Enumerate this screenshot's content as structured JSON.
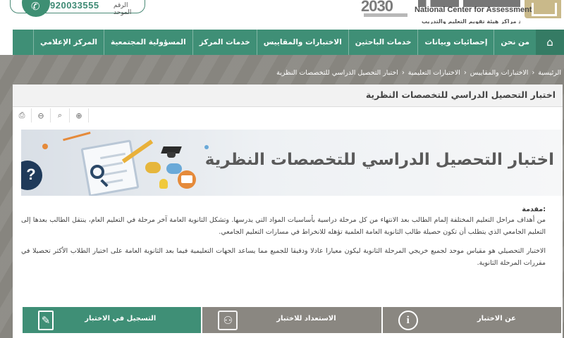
{
  "header": {
    "hotline_label": "الرقم الموحد",
    "hotline_number": "920033555",
    "center_name_en": "National Center for Assessment",
    "center_subtitle": "أحد مراكز هيئة تقويم التعليم والتدريب",
    "vision_year": "2030"
  },
  "nav": {
    "items": [
      "من نحن",
      "إحصائيات وبيانات",
      "خدمات الباحثين",
      "الاختبارات والمقاييس",
      "خدمات المركز",
      "المسؤولية المجتمعية",
      "المركز الإعلامي"
    ]
  },
  "breadcrumb": [
    "الرئيسية",
    "الاختبارات والمقاييس",
    "الاختبارات التعليمية",
    "اختبار التحصيل الدراسي للتخصصات النظرية"
  ],
  "page": {
    "title": "اختبار التحصيل الدراسي للتخصصات النظرية",
    "banner_text": "اختبار التحصيل الدراسي للتخصصات النظرية",
    "intro_heading": "مقدمة:",
    "paragraph_1": "من أهداف مراحل التعليم المختلفة إلمام الطالب بعد الانتهاء من كل مرحلة دراسية بأساسيات المواد التي يدرسها. وتشكل الثانوية العامة آخر مرحلة في التعليم العام، ينتقل الطالب بعدها إلى التعليم الجامعي الذي يتطلب أن تكون حصيلة طالب الثانوية العامة العلمية تؤهله للانخراط في مسارات التعليم الجامعي.",
    "paragraph_2": "الاختبار التحصيلي هو مقياس موحد لجميع خريجي المرحلة الثانوية ليكون معيارا عادلا ودقيقا للجميع مما يساعد الجهات التعليمية فيما بعد الثانوية العامة على اختيار الطلاب الأكثر تحصيلا في مقررات المرحلة الثانوية."
  },
  "buttons": {
    "about": "عن الاختبار",
    "prepare": "الاستعداد للاختبار",
    "register": "التسجيل في الاختبار"
  },
  "colors": {
    "brand_green": "#3f8f76",
    "gray_button": "#8a8781",
    "band_gray": "#8c8a84"
  },
  "icons": {
    "home": "home-icon",
    "phone": "phone-icon",
    "print": "print-icon",
    "zoom_out": "zoom-out-icon",
    "zoom_reset": "zoom-reset-icon",
    "zoom_in": "zoom-in-icon",
    "info": "info-icon",
    "prepare": "people-icon",
    "register": "document-pen-icon"
  }
}
